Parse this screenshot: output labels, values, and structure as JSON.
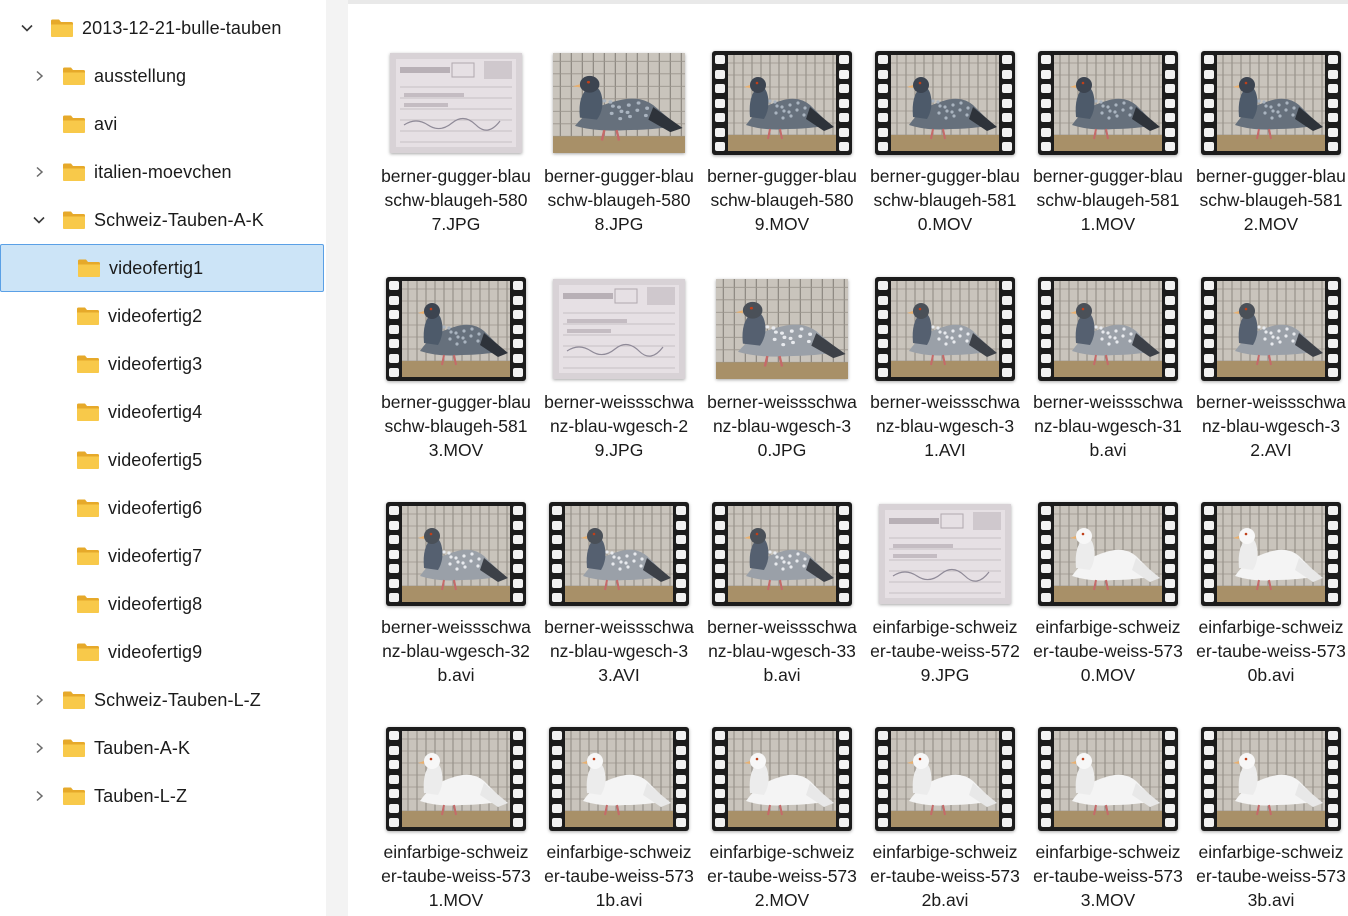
{
  "sidebar": {
    "items": [
      {
        "label": "2013-12-21-bulle-tauben",
        "chevron": "down",
        "level": 0
      },
      {
        "label": "ausstellung",
        "chevron": "right",
        "level": 1
      },
      {
        "label": "avi",
        "chevron": "none",
        "level": 1
      },
      {
        "label": "italien-moevchen",
        "chevron": "right",
        "level": 1
      },
      {
        "label": "Schweiz-Tauben-A-K",
        "chevron": "down",
        "level": 1
      },
      {
        "label": "videofertig1",
        "chevron": "none",
        "level": 2,
        "selected": true
      },
      {
        "label": "videofertig2",
        "chevron": "none",
        "level": 2
      },
      {
        "label": "videofertig3",
        "chevron": "none",
        "level": 2
      },
      {
        "label": "videofertig4",
        "chevron": "none",
        "level": 2
      },
      {
        "label": "videofertig5",
        "chevron": "none",
        "level": 2
      },
      {
        "label": "videofertig6",
        "chevron": "none",
        "level": 2
      },
      {
        "label": "videofertig7",
        "chevron": "none",
        "level": 2
      },
      {
        "label": "videofertig8",
        "chevron": "none",
        "level": 2
      },
      {
        "label": "videofertig9",
        "chevron": "none",
        "level": 2
      },
      {
        "label": "Schweiz-Tauben-L-Z",
        "chevron": "right",
        "level": 1
      },
      {
        "label": "Tauben-A-K",
        "chevron": "right",
        "level": 1
      },
      {
        "label": "Tauben-L-Z",
        "chevron": "right",
        "level": 1
      }
    ]
  },
  "files": [
    {
      "name": "berner-gugger-blauschw-blaugeh-5807.JPG",
      "kind": "photo",
      "subject": "card"
    },
    {
      "name": "berner-gugger-blauschw-blaugeh-5808.JPG",
      "kind": "photo",
      "subject": "dark-pigeon"
    },
    {
      "name": "berner-gugger-blauschw-blaugeh-5809.MOV",
      "kind": "video",
      "subject": "dark-pigeon"
    },
    {
      "name": "berner-gugger-blauschw-blaugeh-5810.MOV",
      "kind": "video",
      "subject": "dark-pigeon"
    },
    {
      "name": "berner-gugger-blauschw-blaugeh-5811.MOV",
      "kind": "video",
      "subject": "dark-pigeon"
    },
    {
      "name": "berner-gugger-blauschw-blaugeh-5812.MOV",
      "kind": "video",
      "subject": "dark-pigeon"
    },
    {
      "name": "berner-gugger-blauschw-blaugeh-5813.MOV",
      "kind": "video",
      "subject": "dark-pigeon"
    },
    {
      "name": "berner-weissschwanz-blau-wgesch-29.JPG",
      "kind": "photo",
      "subject": "card"
    },
    {
      "name": "berner-weissschwanz-blau-wgesch-30.JPG",
      "kind": "photo",
      "subject": "grey-pigeon"
    },
    {
      "name": "berner-weissschwanz-blau-wgesch-31.AVI",
      "kind": "video",
      "subject": "grey-pigeon"
    },
    {
      "name": "berner-weissschwanz-blau-wgesch-31b.avi",
      "kind": "video",
      "subject": "grey-pigeon"
    },
    {
      "name": "berner-weissschwanz-blau-wgesch-32.AVI",
      "kind": "video",
      "subject": "grey-pigeon"
    },
    {
      "name": "berner-weissschwanz-blau-wgesch-32b.avi",
      "kind": "video",
      "subject": "grey-pigeon"
    },
    {
      "name": "berner-weissschwanz-blau-wgesch-33.AVI",
      "kind": "video",
      "subject": "grey-pigeon"
    },
    {
      "name": "berner-weissschwanz-blau-wgesch-33b.avi",
      "kind": "video",
      "subject": "grey-pigeon"
    },
    {
      "name": "einfarbige-schweizer-taube-weiss-5729.JPG",
      "kind": "photo",
      "subject": "card"
    },
    {
      "name": "einfarbige-schweizer-taube-weiss-5730.MOV",
      "kind": "video",
      "subject": "white-pigeon"
    },
    {
      "name": "einfarbige-schweizer-taube-weiss-5730b.avi",
      "kind": "video",
      "subject": "white-pigeon"
    },
    {
      "name": "einfarbige-schweizer-taube-weiss-5731.MOV",
      "kind": "video",
      "subject": "white-pigeon"
    },
    {
      "name": "einfarbige-schweizer-taube-weiss-5731b.avi",
      "kind": "video",
      "subject": "white-pigeon"
    },
    {
      "name": "einfarbige-schweizer-taube-weiss-5732.MOV",
      "kind": "video",
      "subject": "white-pigeon"
    },
    {
      "name": "einfarbige-schweizer-taube-weiss-5732b.avi",
      "kind": "video",
      "subject": "white-pigeon"
    },
    {
      "name": "einfarbige-schweizer-taube-weiss-5733.MOV",
      "kind": "video",
      "subject": "white-pigeon"
    },
    {
      "name": "einfarbige-schweizer-taube-weiss-5733b.avi",
      "kind": "video",
      "subject": "white-pigeon"
    }
  ],
  "colors": {
    "folder": "#f8c94a",
    "selection_bg": "#cce4f7",
    "selection_border": "#5aa0e6",
    "film": "#1c1c1c"
  }
}
